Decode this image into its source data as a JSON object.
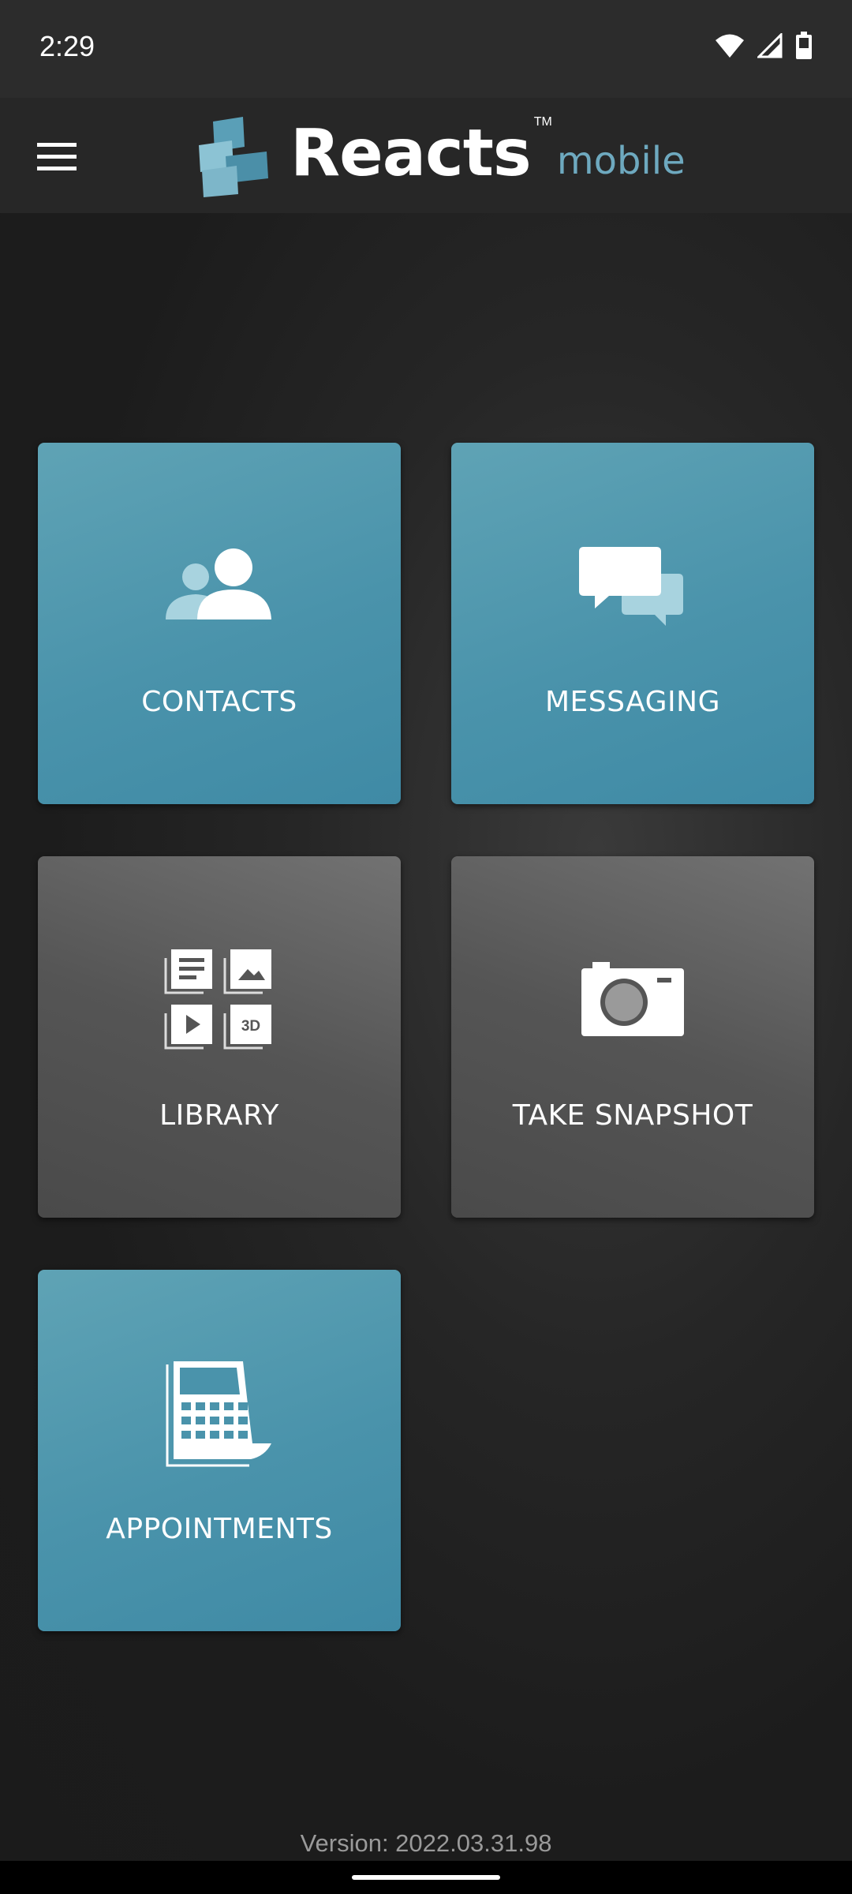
{
  "status_bar": {
    "time": "2:29",
    "icons": [
      "wifi-icon",
      "signal-icon",
      "battery-icon"
    ]
  },
  "app_bar": {
    "menu_icon": "hamburger-menu-icon",
    "logo": {
      "word": "Reacts",
      "tm": "TM",
      "sub": "mobile"
    }
  },
  "tiles": [
    {
      "label": "CONTACTS",
      "icon": "contacts-icon",
      "style": "blue"
    },
    {
      "label": "MESSAGING",
      "icon": "messaging-icon",
      "style": "blue"
    },
    {
      "label": "LIBRARY",
      "icon": "library-icon",
      "style": "gray"
    },
    {
      "label": "TAKE SNAPSHOT",
      "icon": "camera-icon",
      "style": "gray"
    },
    {
      "label": "APPOINTMENTS",
      "icon": "calendar-icon",
      "style": "blue"
    }
  ],
  "library_badge": "3D",
  "version": "Version: 2022.03.31.98",
  "colors": {
    "tile_blue": "#4a93ab",
    "tile_gray": "#5a5a5a",
    "logo_sub": "#6ea9bf"
  }
}
